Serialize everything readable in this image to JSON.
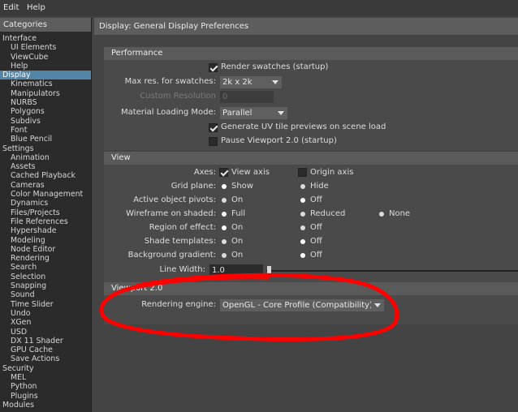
{
  "menu": {
    "edit": "Edit",
    "help": "Help"
  },
  "sidebar": {
    "header": "Categories",
    "items": [
      {
        "label": "Interface",
        "level": 0
      },
      {
        "label": "UI Elements",
        "level": 1
      },
      {
        "label": "ViewCube",
        "level": 1
      },
      {
        "label": "Help",
        "level": 1
      },
      {
        "label": "Display",
        "level": 0,
        "selected": true
      },
      {
        "label": "Kinematics",
        "level": 1
      },
      {
        "label": "Manipulators",
        "level": 1
      },
      {
        "label": "NURBS",
        "level": 1
      },
      {
        "label": "Polygons",
        "level": 1
      },
      {
        "label": "Subdivs",
        "level": 1
      },
      {
        "label": "Font",
        "level": 1
      },
      {
        "label": "Blue Pencil",
        "level": 1
      },
      {
        "label": "Settings",
        "level": 0
      },
      {
        "label": "Animation",
        "level": 1
      },
      {
        "label": "Assets",
        "level": 1
      },
      {
        "label": "Cached Playback",
        "level": 1
      },
      {
        "label": "Cameras",
        "level": 1
      },
      {
        "label": "Color Management",
        "level": 1
      },
      {
        "label": "Dynamics",
        "level": 1
      },
      {
        "label": "Files/Projects",
        "level": 1
      },
      {
        "label": "File References",
        "level": 1
      },
      {
        "label": "Hypershade",
        "level": 1
      },
      {
        "label": "Modeling",
        "level": 1
      },
      {
        "label": "Node Editor",
        "level": 1
      },
      {
        "label": "Rendering",
        "level": 1
      },
      {
        "label": "Search",
        "level": 1
      },
      {
        "label": "Selection",
        "level": 1
      },
      {
        "label": "Snapping",
        "level": 1
      },
      {
        "label": "Sound",
        "level": 1
      },
      {
        "label": "Time Slider",
        "level": 1
      },
      {
        "label": "Undo",
        "level": 1
      },
      {
        "label": "XGen",
        "level": 1
      },
      {
        "label": "USD",
        "level": 1
      },
      {
        "label": "DX 11 Shader",
        "level": 1
      },
      {
        "label": "GPU Cache",
        "level": 1
      },
      {
        "label": "Save Actions",
        "level": 1
      },
      {
        "label": "Security",
        "level": 0
      },
      {
        "label": "MEL",
        "level": 1
      },
      {
        "label": "Python",
        "level": 1
      },
      {
        "label": "Plugins",
        "level": 1
      },
      {
        "label": "Modules",
        "level": 0
      }
    ]
  },
  "main": {
    "title": "Display: General Display Preferences",
    "performance": {
      "header": "Performance",
      "render_swatches": "Render swatches (startup)",
      "max_res_label": "Max res. for swatches:",
      "max_res_value": "2k x 2k",
      "custom_res_label": "Custom Resolution",
      "custom_res_value": "0",
      "material_mode_label": "Material Loading Mode:",
      "material_mode_value": "Parallel",
      "uv_previews": "Generate UV tile previews on scene load",
      "pause_viewport": "Pause Viewport 2.0 (startup)"
    },
    "view": {
      "header": "View",
      "axes_label": "Axes:",
      "axes_view": "View axis",
      "axes_origin": "Origin axis",
      "grid_label": "Grid plane:",
      "grid_show": "Show",
      "grid_hide": "Hide",
      "pivots_label": "Active object pivots:",
      "pivots_on": "On",
      "pivots_off": "Off",
      "wire_label": "Wireframe on shaded:",
      "wire_full": "Full",
      "wire_reduced": "Reduced",
      "wire_none": "None",
      "region_label": "Region of effect:",
      "region_on": "On",
      "region_off": "Off",
      "shade_label": "Shade templates:",
      "shade_on": "On",
      "shade_off": "Off",
      "bg_label": "Background gradient:",
      "bg_on": "On",
      "bg_off": "Off",
      "line_width_label": "Line Width:",
      "line_width_value": "1.0"
    },
    "viewport": {
      "header": "Viewport 2.0",
      "engine_label": "Rendering engine:",
      "engine_value": "OpenGL - Core Profile (Compatibility)"
    }
  },
  "colors": {
    "selection": "#5285a6",
    "annotation": "#ff0000"
  }
}
